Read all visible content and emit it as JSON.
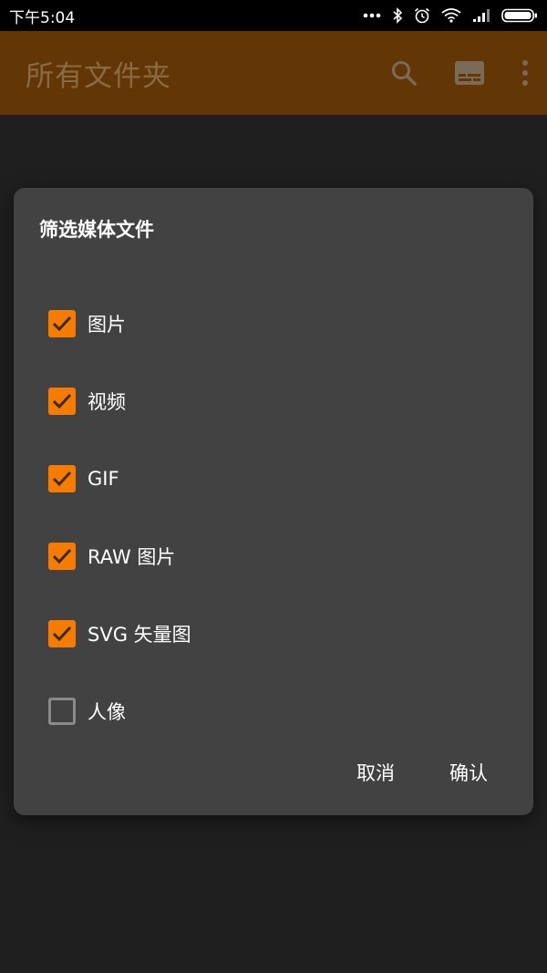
{
  "status_bar": {
    "time": "下午5:04"
  },
  "app_bar": {
    "title": "所有文件夹",
    "actions": [
      "search-icon",
      "subtitles-icon",
      "more-vert-icon"
    ]
  },
  "dialog": {
    "title": "筛选媒体文件",
    "options": [
      {
        "label": "图片",
        "checked": true
      },
      {
        "label": "视频",
        "checked": true
      },
      {
        "label": "GIF",
        "checked": true
      },
      {
        "label": "RAW 图片",
        "checked": true
      },
      {
        "label": "SVG 矢量图",
        "checked": true
      },
      {
        "label": "人像",
        "checked": false
      }
    ],
    "cancel_label": "取消",
    "confirm_label": "确认"
  },
  "colors": {
    "accent": "#f57c00",
    "dialog_bg": "#424242",
    "scrim_bg": "#1f1f1f",
    "app_bar_dimmed": "#633606"
  }
}
